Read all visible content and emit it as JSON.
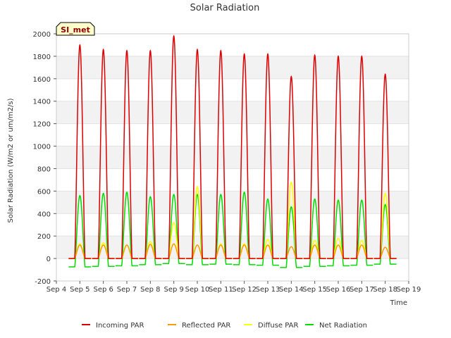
{
  "chart_data": {
    "type": "line",
    "title": "Solar Radiation",
    "xlabel": "Time",
    "ylabel": "Solar Radiation (W/m2 or um/m2/s)",
    "ylim": [
      -200,
      2000
    ],
    "yticks": [
      -200,
      0,
      200,
      400,
      600,
      800,
      1000,
      1200,
      1400,
      1600,
      1800,
      2000
    ],
    "xlim": [
      4,
      19
    ],
    "xticks": [
      4,
      5,
      6,
      7,
      8,
      9,
      10,
      11,
      12,
      13,
      14,
      15,
      16,
      17,
      18,
      19
    ],
    "xtick_labels": [
      "Sep 4",
      "Sep 5",
      "Sep 6",
      "Sep 7",
      "Sep 8",
      "Sep 9",
      "Sep 10",
      "Sep 11",
      "Sep 12",
      "Sep 13",
      "Sep 14",
      "Sep 15",
      "Sep 16",
      "Sep 17",
      "Sep 18",
      "Sep 19"
    ],
    "grid": "horizontal bands",
    "legend_position": "bottom",
    "site_label": "SI_met",
    "days": [
      5,
      6,
      7,
      8,
      9,
      10,
      11,
      12,
      13,
      14,
      15,
      16,
      17,
      18
    ],
    "series": [
      {
        "name": "Incoming PAR",
        "color": "#dd0000",
        "peaks": [
          1900,
          1860,
          1850,
          1850,
          1980,
          1860,
          1850,
          1820,
          1820,
          1620,
          1810,
          1800,
          1800,
          1640
        ]
      },
      {
        "name": "Reflected PAR",
        "color": "#ff9900",
        "peaks": [
          120,
          120,
          120,
          125,
          130,
          120,
          120,
          120,
          120,
          105,
          120,
          120,
          120,
          100
        ]
      },
      {
        "name": "Diffuse PAR",
        "color": "#ffff00",
        "peaks": [
          130,
          140,
          120,
          150,
          320,
          640,
          130,
          130,
          170,
          680,
          160,
          180,
          160,
          580
        ]
      },
      {
        "name": "Net Radiation",
        "color": "#00dd00",
        "peaks": [
          560,
          580,
          590,
          550,
          570,
          570,
          570,
          590,
          530,
          460,
          530,
          520,
          520,
          480
        ],
        "night": [
          -75,
          -70,
          -65,
          -55,
          -45,
          -55,
          -50,
          -55,
          -60,
          -80,
          -70,
          -65,
          -60,
          -50
        ]
      }
    ]
  }
}
